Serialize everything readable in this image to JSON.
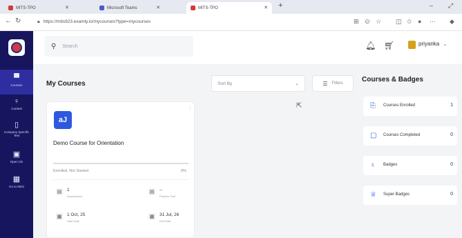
{
  "browser": {
    "tabs": [
      {
        "label": "MITS-TPO"
      },
      {
        "label": "Microsoft Teams"
      },
      {
        "label": "MITS-TPO"
      }
    ],
    "new_tab_label": "+",
    "url": "https://mits923.examly.io/mycourses?type=mycourses"
  },
  "sidebar": {
    "items": [
      {
        "label": "Courses",
        "icon": "book-icon"
      },
      {
        "label": "Contest",
        "icon": "trophy-icon"
      },
      {
        "label": "Company Specific Test",
        "icon": "clipboard-icon"
      },
      {
        "label": "Open CE",
        "icon": "code-icon"
      },
      {
        "label": "Go to NEO",
        "icon": "grid-icon"
      }
    ]
  },
  "header": {
    "search_placeholder": "Search",
    "username": "priyanka"
  },
  "main": {
    "title": "My Courses",
    "sort_placeholder": "Sort By",
    "filters_label": "Filters"
  },
  "course_card": {
    "title": "Demo Course for Orientation",
    "icon_text": "aJ",
    "status": "Enrolled, Not Started",
    "progress_text": "0%",
    "progress": 0,
    "stats": [
      {
        "value": "1",
        "label": "Assessment"
      },
      {
        "value": "--",
        "label": "Practice Test"
      },
      {
        "value": "1 Oct, 25",
        "label": "Start Date"
      },
      {
        "value": "31 Jul, 26",
        "label": "End Date"
      }
    ]
  },
  "right_panel": {
    "title": "Courses & Badges",
    "cards": [
      {
        "label": "Courses Enrolled",
        "count": "1"
      },
      {
        "label": "Courses Completed",
        "count": "0"
      },
      {
        "label": "Badges",
        "count": "0"
      },
      {
        "label": "Super Badges",
        "count": "0"
      }
    ]
  },
  "colors": {
    "sidebar_bg": "#16155e",
    "accent": "#2e58e0"
  }
}
